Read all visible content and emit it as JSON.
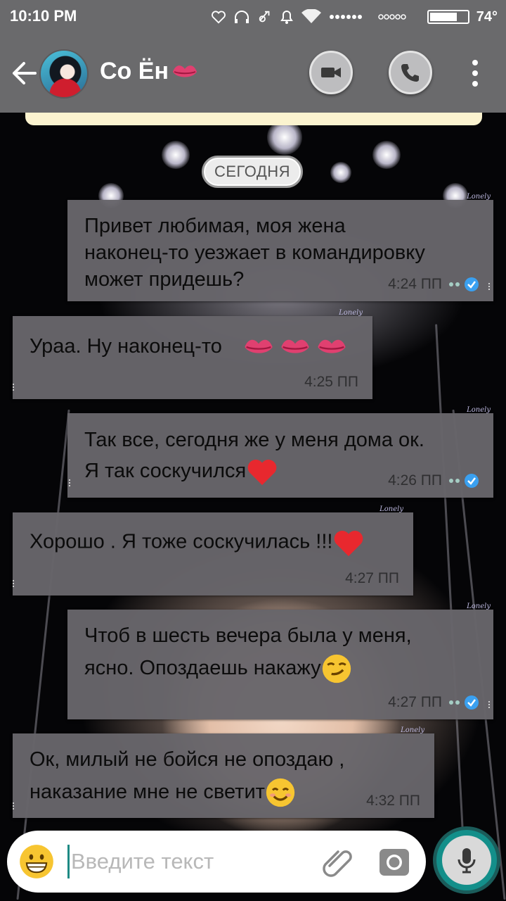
{
  "status_bar": {
    "time": "10:10 PM",
    "battery": "74°",
    "battery_level": 0.74
  },
  "header": {
    "contact_name": "Со Ён",
    "avatar_icon": "avatar-photo",
    "back_icon": "arrow-left-icon",
    "video_icon": "video-camera-icon",
    "call_icon": "phone-icon",
    "menu_icon": "more-vert-icon"
  },
  "date_chip": "СЕГОДНЯ",
  "messages": [
    {
      "direction": "out",
      "lines": [
        "Привет любимая, моя жена",
        "наконец-то уезжает в командировку",
        "может придешь?"
      ],
      "time": "4:24 ПП",
      "status": "read"
    },
    {
      "direction": "in",
      "lines": [
        "Ураа. Ну  наконец-то"
      ],
      "emoji": [
        "kiss-mark",
        "kiss-mark",
        "kiss-mark"
      ],
      "time": "4:25 ПП"
    },
    {
      "direction": "out",
      "lines": [
        "Так все,  сегодня же у меня дома ок.",
        "Я так соскучился"
      ],
      "emoji": [
        "red-heart"
      ],
      "time": "4:26 ПП",
      "status": "read"
    },
    {
      "direction": "in",
      "lines": [
        "Хорошо . Я тоже соскучилась !!!"
      ],
      "emoji": [
        "red-heart"
      ],
      "time": "4:27 ПП"
    },
    {
      "direction": "out",
      "lines": [
        "Чтоб в шесть вечера была у меня,",
        "ясно. Опоздаешь накажу"
      ],
      "emoji": [
        "smirking-face"
      ],
      "time": "4:27 ПП",
      "status": "read"
    },
    {
      "direction": "in",
      "lines": [
        "Ок, милый не бойся  не опоздаю ,",
        "наказание мне  не  светит"
      ],
      "emoji": [
        "smiling-face"
      ],
      "time": "4:32 ПП"
    }
  ],
  "input": {
    "placeholder": "Введите текст",
    "emoji_icon": "grinning-face-icon",
    "attach_icon": "paperclip-icon",
    "camera_icon": "camera-icon",
    "mic_icon": "microphone-icon"
  },
  "colors": {
    "bar": "#6a6a6c",
    "bubble": "#67656a",
    "accent": "#138f8a",
    "read_tick": "#3aa0f0"
  }
}
